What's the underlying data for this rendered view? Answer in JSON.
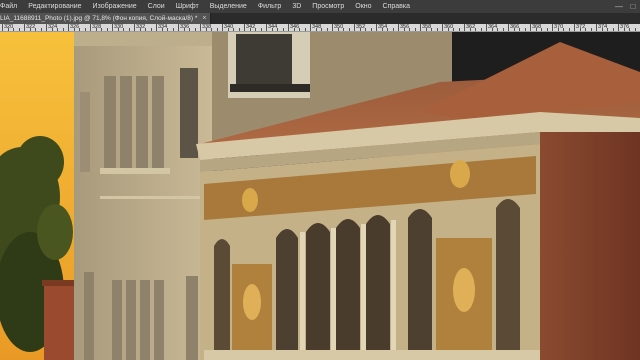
{
  "menubar": {
    "items": [
      "Файл",
      "Редактирование",
      "Изображение",
      "Слои",
      "Шрифт",
      "Выделение",
      "Фильтр",
      "3D",
      "Просмотр",
      "Окно",
      "Справка"
    ],
    "minimize_icon": "minimize-icon",
    "maximize_icon": "maximize-icon"
  },
  "document_tab": {
    "title": "LIA_11688911_Photo (1).jpg @ 71,8% (Фон копия, Слой-маска/8) *",
    "close_glyph": "×"
  },
  "ruler": {
    "labels": [
      "320",
      "322",
      "324",
      "326",
      "328",
      "330",
      "332",
      "334",
      "336",
      "338",
      "340",
      "342",
      "344",
      "346",
      "348",
      "350",
      "352",
      "354",
      "356",
      "358",
      "360",
      "362",
      "364",
      "366",
      "368",
      "370",
      "372",
      "374",
      "376"
    ]
  },
  "colors": {
    "sky": "#f2b233",
    "menubar_bg": "#3c3c3c",
    "tab_bg": "#535353",
    "ruler_bg": "#d8d8d8"
  }
}
